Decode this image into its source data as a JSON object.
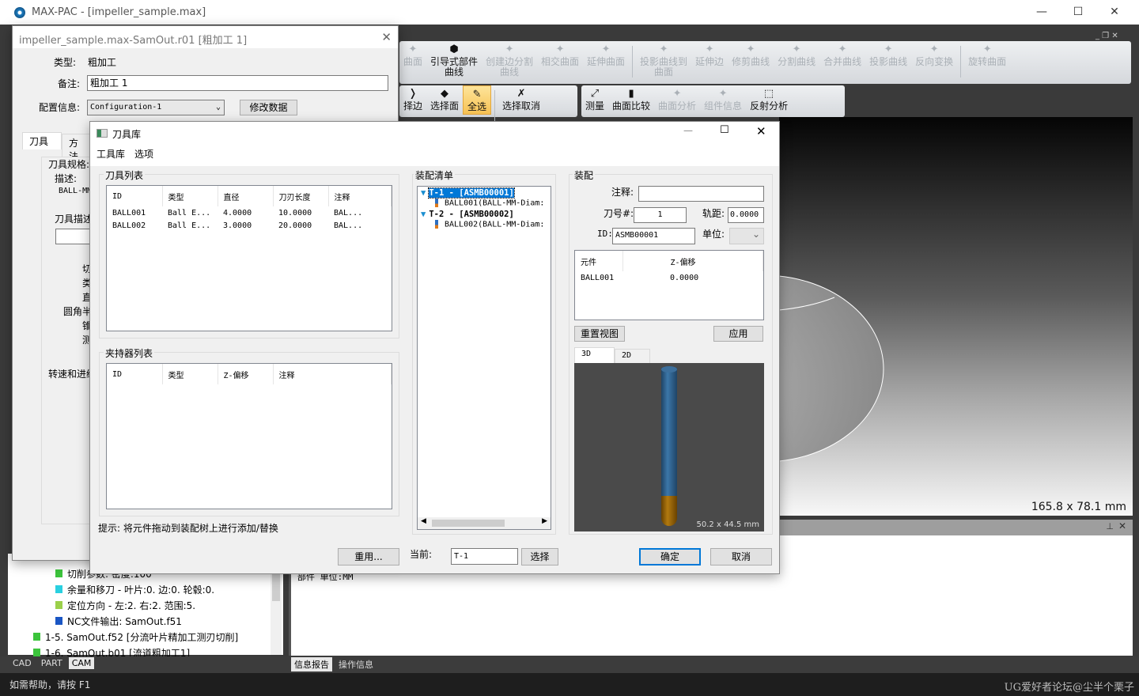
{
  "app": {
    "title": "MAX-PAC - [impeller_sample.max]",
    "minimize": "—",
    "maximize": "☐",
    "close": "✕"
  },
  "ribbon1": [
    {
      "label": "曲面",
      "icon": "surface-icon",
      "enabled": false
    },
    {
      "label": "引导式部件曲线",
      "icon": "guide-curve-icon",
      "enabled": true
    },
    {
      "label": "创建边分割曲线",
      "icon": "edge-split-icon",
      "enabled": false
    },
    {
      "label": "相交曲面",
      "icon": "intersect-surface-icon",
      "enabled": false
    },
    {
      "label": "延伸曲面",
      "icon": "extend-surface-icon",
      "enabled": false
    },
    {
      "label": "投影曲线到曲面",
      "icon": "project-curve-icon",
      "enabled": false
    },
    {
      "label": "延伸边",
      "icon": "extend-edge-icon",
      "enabled": false
    },
    {
      "label": "修剪曲线",
      "icon": "trim-curve-icon",
      "enabled": false
    },
    {
      "label": "分割曲线",
      "icon": "split-curve-icon",
      "enabled": false
    },
    {
      "label": "合并曲线",
      "icon": "merge-curve-icon",
      "enabled": false
    },
    {
      "label": "投影曲线",
      "icon": "project-icon",
      "enabled": false
    },
    {
      "label": "反向变换",
      "icon": "reverse-icon",
      "enabled": false
    },
    {
      "label": "旋转曲面",
      "icon": "rotate-surface-icon",
      "enabled": false
    }
  ],
  "ribbon2a": [
    {
      "label": "择边",
      "icon": "select-edge-icon",
      "enabled": true
    },
    {
      "label": "选择面",
      "icon": "select-face-icon",
      "enabled": true
    },
    {
      "label": "全选",
      "icon": "select-all-icon",
      "enabled": true,
      "active": true
    },
    {
      "label": "选择取消",
      "icon": "deselect-icon",
      "enabled": true
    }
  ],
  "ribbon2b": [
    {
      "label": "测量",
      "icon": "measure-icon",
      "enabled": true
    },
    {
      "label": "曲面比较",
      "icon": "surface-compare-icon",
      "enabled": true
    },
    {
      "label": "曲面分析",
      "icon": "surface-analysis-icon",
      "enabled": false
    },
    {
      "label": "组件信息",
      "icon": "component-info-icon",
      "enabled": false
    },
    {
      "label": "反射分析",
      "icon": "reflection-icon",
      "enabled": true
    }
  ],
  "viewport": {
    "dims": "165.8 x 78.1 mm"
  },
  "tree": {
    "items": [
      {
        "text": "切削参数: 密度:100",
        "color": "#3cc43c"
      },
      {
        "text": "余量和移刀 - 叶片:0. 边:0. 轮毂:0.",
        "color": "#2ad0e0"
      },
      {
        "text": "定位方向 - 左:2. 右:2. 范围:5.",
        "color": "#9bd04a"
      },
      {
        "text": "NC文件输出: SamOut.f51",
        "color": "#1a56c4"
      },
      {
        "text": "1-5. SamOut.f52 [分流叶片精加工测刃切削]",
        "color": "#3cc43c"
      },
      {
        "text": "1-6. SamOut.b01 [流道粗加工1]",
        "color": "#3cc43c"
      }
    ]
  },
  "info": {
    "text": "部件 单位:MM"
  },
  "bottomtabs": {
    "left": [
      "CAD",
      "PART",
      "CAM"
    ],
    "right": [
      "信息报告",
      "操作信息"
    ]
  },
  "status": {
    "help": "如需帮助，请按 F1",
    "watermark": "UG爱好者论坛@尘半个栗子"
  },
  "op_dialog": {
    "title": "impeller_sample.max-SamOut.r01 [粗加工 1]",
    "type_label": "类型:",
    "type_value": "粗加工",
    "note_label": "备注:",
    "note_value": "粗加工 1",
    "config_label": "配置信息:",
    "config_value": "Configuration-1",
    "modify_button": "修改数据",
    "tabs": [
      "刀具",
      "方法"
    ],
    "spec_label": "刀具规格:",
    "desc_label": "描述:",
    "desc_value": "BALL-MM",
    "tooldesc_label": "刀具描述",
    "fields": [
      "切削",
      "类型",
      "直径",
      "圆角半径",
      "锥形",
      "测量"
    ],
    "feed_label": "转速和进给"
  },
  "lib": {
    "title": "刀具库",
    "menu": [
      "工具库",
      "选项"
    ],
    "tool_list_label": "刀具列表",
    "tool_cols": [
      "ID",
      "类型",
      "直径",
      "刀刃长度",
      "注释"
    ],
    "tools": [
      [
        "BALL001",
        "Ball E...",
        "4.0000",
        "10.0000",
        "BAL..."
      ],
      [
        "BALL002",
        "Ball E...",
        "3.0000",
        "20.0000",
        "BAL..."
      ]
    ],
    "holder_list_label": "夹持器列表",
    "holder_cols": [
      "ID",
      "类型",
      "Z-偏移",
      "注释"
    ],
    "hint": "提示: 将元件拖动到装配树上进行添加/替换",
    "reuse_button": "重用...",
    "current_label": "当前:",
    "current_value": "T-1",
    "select_button": "选择",
    "asm_list_label": "装配清单",
    "asm": [
      {
        "label": "T-1 - [ASMB00001]",
        "child": "BALL001(BALL-MM-Diam:",
        "selected": true
      },
      {
        "label": "T-2 - [ASMB00002]",
        "child": "BALL002(BALL-MM-Diam:",
        "selected": false
      }
    ],
    "asm_label": "装配",
    "note_label": "注释:",
    "note_value": "",
    "toolno_label": "刀号#:",
    "toolno_value": "1",
    "track_label": "轨距:",
    "track_value": "0.0000",
    "id_label": "ID:",
    "id_value": "ASMB00001",
    "unit_label": "单位:",
    "unit_value": "",
    "comp_cols": [
      "元件",
      "Z-偏移"
    ],
    "comps": [
      [
        "BALL001",
        "0.0000"
      ]
    ],
    "reset_view_button": "重置视图",
    "apply_button": "应用",
    "view_tabs": [
      "3D",
      "2D"
    ],
    "preview_dims": "50.2 x 44.5 mm",
    "ok_button": "确定",
    "cancel_button": "取消"
  }
}
